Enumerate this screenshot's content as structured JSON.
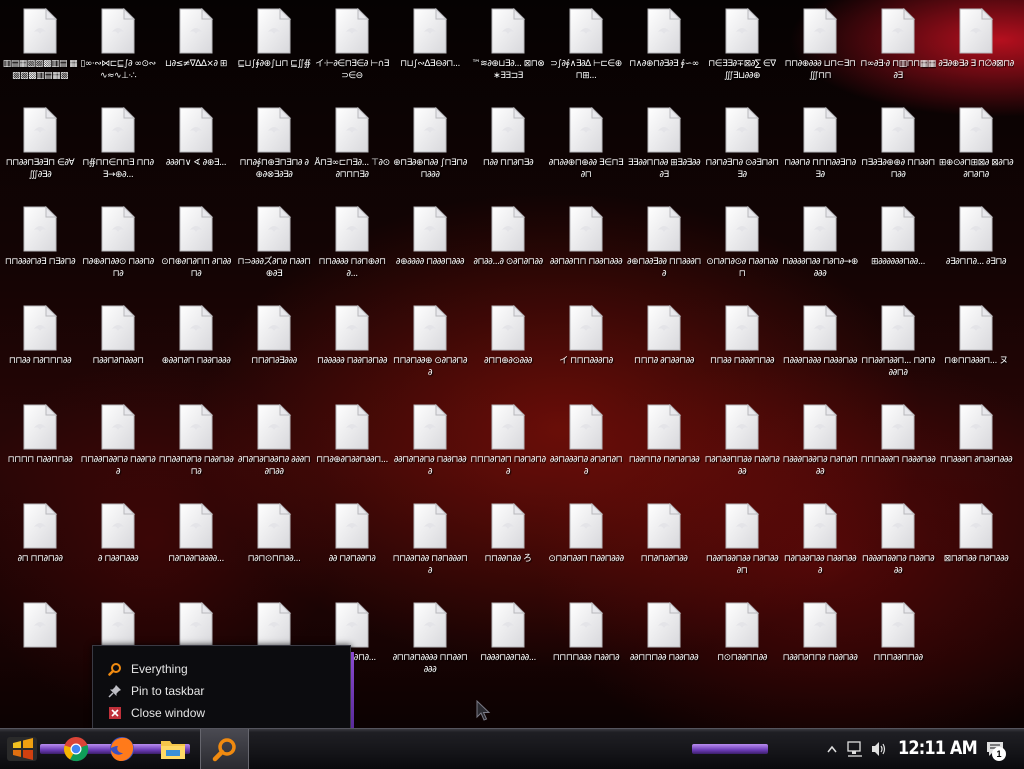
{
  "desktop": {
    "icons": [
      "▥▤▦▧▨▩▥▤ ▦▧▨▩▥▤▦▧",
      "▯∞·∾⋈⊏⊑∫∂ ∞⊙∾∿≈∿⊥·∴",
      "⊔∂≤≠∇∆∆⨯∂ ⊞",
      "⊑⊔∫∮∂⊕∫⊔⊓ ⊑∬∯",
      "イ·⊢∂∈⊓∃∈∂ ⊢∩∃⊃∈⊖",
      "⊓⊔∫∾∆∃⊖∂⊓...",
      "™≋∂⊕⊔∃∂... ⊠⊓⊗∗∃∃⊐∃",
      "⊃∫∂∮∧∃∂∆ ⊢⊏∈⊕⊓⊞...",
      "⊓∧∂⊕⊓∂∃∂∃ ∮∽∞",
      "⊓∈∃∃∂∓⊠∂∑ ∈∇∭∃⊔∂∂⊕",
      "⊓⊓∂⊕∂∂∂ ⊔⊓⊂∃⊓∭⊓⊓",
      "⊓∞∂∃·∂ ⊓▥⊓⊓▦▦∂∃",
      "∂∃∂⊕∃∂ ∃ ⊓∅∂⊠⊓∂",
      "⊓⊓∂∂⊓∃∂∃⊓ ∈∂∀∭∂∃∂",
      "⊓∯⊓⊓∈⊓⊓∃ ⊓⊓∂∃→⊕∂...",
      "∂∂∂⊓∨ ∢ ∂⊕∃...",
      "⊓⊓∂∮⊓⊕∃⊓∃⊓∂ ∂⊕∂⊗∃∂∃∂",
      "Å⊓∃∞⊏⊓∃∂... ⊤∂⊙∂⊓⊓⊓∃∂",
      "⊕⊓∃∂⊕⊓∂∂ ∫⊓∃⊓∂⊓∂∂∂",
      "⊓∂∂ ⊓⊓∂⊓∃∂",
      "∂⊓∂∂⊕⊓⊕∂∂ ∃∈⊓∃∂⊓",
      "∃∃∂∂⊓⊓∂∂ ⊞∃∂∃∂∂∂∃",
      "⊓∂⊓∂∃⊓∂ ⊙∂∃⊓∂⊓∃∂",
      "⊓∂∂⊓∂ ⊓⊓⊓∂∂∃⊓∂∃∂",
      "⊓∃∂∃∂⊕⊕∂ ⊓⊓∂∂⊓⊓∂∂",
      "⊞⊕⊙∂⊓⊞⊠∂ ⊠∂⊓∂∂⊓∂⊓∂",
      "⊓⊓∂∂∂⊓∂∃ ⊓∃∂⊓∂",
      "⊓∂⊕∂⊓∂∂⊙ ⊓∂∂⊓∂⊓∂",
      "⊙⊓⊕∂⊓∂⊓⊓ ∂⊓∂∂⊓∂",
      "⊓⊃∂∂∂ズ∂⊓∂ ⊓∂∂⊓⊕∂∃",
      "⊓⊓∂∂∂∂ ⊓∂⊓⊕∂⊓∂...",
      "∂⊕∂∂∂∂ ⊓∂∂∂⊓∂∂∂",
      "∂⊓∂∂...∂ ⊙∂⊓∂⊓∂∂",
      "∂∂⊓∂∂⊓⊓ ⊓∂∂⊓∂∂∂",
      "∂⊕⊓∂∂∃∂∂ ⊓⊓∂∂∂⊓∂",
      "⊙⊓∂⊓∂⊙∂ ⊓∂∂⊓∂∂⊓",
      "⊓∂∂∂∂⊓∂∂ ⊓∂⊓∂→⊕∂∂∂",
      "⊞∂∂∂∂∂∂⊓∂∂...",
      "∂∃∂⊓⊓∂... ∂∃⊓∂",
      "⊓⊓∂∂ ⊓∂⊓⊓⊓∂∂",
      "⊓∂∂⊓∂⊓∂∂∂⊓",
      "⊕∂∂⊓∂⊓ ⊓∂∂⊓∂∂∂",
      "⊓⊓∂⊓∂∃∂∂∂",
      "⊓∂∂∂∂∂ ⊓∂∂⊓∂⊓∂∂",
      "⊓⊓∂⊓∂∂⊕ ⊙∂⊓∂⊓∂∂",
      "∂⊓⊓⊕∂⊙∂∂∂",
      "イ ⊓⊓⊓∂∂∂⊓∂",
      "⊓⊓⊓∂ ∂⊓∂∂⊓∂∂",
      "⊓⊓∂∂ ⊓∂∂∂⊓⊓∂∂",
      "⊓∂∂∂⊓∂∂∂ ⊓∂∂∂⊓∂∂",
      "⊓⊓∂∂⊓∂∂⊓... ⊓∂⊓∂∂∂⊓∂",
      "⊓⊕⊓⊓∂∂∂⊓... ヌ",
      "⊓⊓⊓⊓ ⊓∂∂⊓⊓∂∂",
      "⊓⊓∂∂⊓∂∂⊓∂ ⊓∂∂⊓∂∂",
      "⊓⊓∂∂⊓∂⊓∂ ⊓∂∂⊓∂∂⊓∂",
      "∂⊓∂⊓∂⊓∂∂⊓∂ ∂∂∂⊓∂⊓∂∂",
      "⊓⊓∂⊕∂⊓∂∂⊓∂∂⊓...",
      "∂∂⊓∂⊓∂⊓∂ ⊓∂∂⊓∂∂∂",
      "⊓⊓⊓∂⊓∂⊓ ⊓∂⊓∂⊓∂∂",
      "∂∂⊓∂∂∂⊓∂ ∂⊓∂⊓∂⊓∂",
      "⊓∂∂⊓⊓∂ ⊓∂⊓∂⊓∂∂",
      "⊓∂⊓∂∂⊓⊓∂∂ ⊓∂∂⊓∂∂∂",
      "⊓∂∂∂⊓∂∂⊓∂ ⊓∂⊓∂⊓∂∂",
      "⊓⊓⊓∂∂∂⊓ ⊓∂∂∂⊓∂∂",
      "⊓⊓∂∂∂⊓ ∂⊓∂∂⊓∂∂∂",
      "∂⊓ ⊓⊓∂⊓∂∂",
      "∂ ⊓∂∂⊓∂∂∂",
      "⊓∂⊓∂∂⊓∂∂∂∂...",
      "⊓∂⊓⊙⊓⊓∂∂...",
      "∂∂ ⊓∂⊓∂∂⊓∂",
      "⊓⊓∂∂⊓∂∂ ⊓∂⊓∂∂∂⊓∂",
      "⊓⊓∂∂⊓∂∂ ろ",
      "⊙⊓∂⊓∂∂⊓ ⊓∂∂⊓∂∂∂",
      "⊓⊓∂⊓∂∂⊓∂∂",
      "⊓∂∂⊓∂∂⊓∂∂ ⊓∂⊓∂∂∂⊓",
      "⊓∂⊓∂∂⊓∂∂ ⊓∂∂⊓∂∂∂",
      "⊓∂∂∂⊓∂∂⊓∂ ⊓∂∂⊓∂∂∂",
      "⊠⊓∂⊓∂∂ ⊓∂⊓∂∂∂",
      "",
      "",
      "",
      "",
      "∂⊓∂⊓∂∂⊓∂...",
      "∂⊓⊓∂⊓∂∂∂∂ ⊓⊓∂∂⊓∂∂∂",
      "⊓∂∂∂⊓∂∂⊓∂∂...",
      "⊓⊓⊓⊓∂∂∂ ⊓∂∂⊓∂",
      "∂∂⊓⊓⊓∂∂ ⊓∂∂⊓∂∂",
      "⊓⊙⊓∂∂⊓⊓∂∂",
      "⊓∂∂⊓∂⊓⊓∂ ⊓∂∂⊓∂∂",
      "⊓⊓⊓∂∂⊓⊓∂∂"
    ]
  },
  "jump_menu": {
    "items": [
      {
        "label": "Everything",
        "icon": "search-icon"
      },
      {
        "label": "Pin to taskbar",
        "icon": "pin-icon"
      },
      {
        "label": "Close window",
        "icon": "close-icon"
      }
    ]
  },
  "taskbar": {
    "clock": "12:11 AM",
    "notification_count": "1",
    "apps": [
      "start-button",
      "chrome-icon",
      "firefox-icon",
      "file-explorer-icon",
      "everything-search-icon"
    ]
  },
  "colors": {
    "accent": "#8a4ad0",
    "search_orange": "#f08a10",
    "close_red": "#c0303a"
  }
}
